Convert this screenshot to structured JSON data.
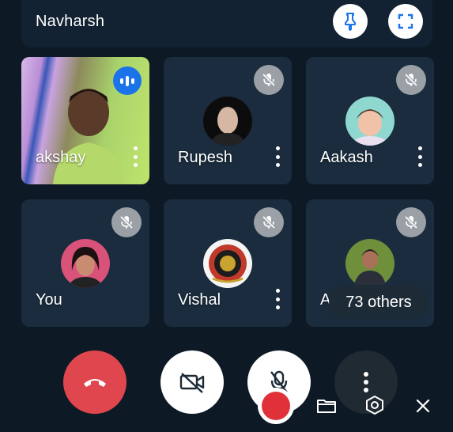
{
  "header": {
    "title": "Navharsh",
    "pin_icon": "pin-icon",
    "fullscreen_icon": "fullscreen-icon"
  },
  "participants": [
    {
      "name": "akshay",
      "video_on": true,
      "speaking": true,
      "muted": false
    },
    {
      "name": "Rupesh",
      "video_on": false,
      "muted": true
    },
    {
      "name": "Aakash",
      "video_on": false,
      "muted": true
    },
    {
      "name": "You",
      "video_on": false,
      "muted": true
    },
    {
      "name": "Vishal",
      "video_on": false,
      "muted": true
    },
    {
      "name": "Anuj",
      "visible_text": "An",
      "video_on": false,
      "muted": true
    }
  ],
  "others_chip": {
    "label": "73 others"
  },
  "controls": [
    {
      "name": "end-call",
      "icon": "phone-hangup-icon",
      "color": "#e0464e"
    },
    {
      "name": "camera-toggle",
      "icon": "video-off-icon",
      "state": "off"
    },
    {
      "name": "mic-toggle",
      "icon": "mic-off-icon",
      "state": "off"
    },
    {
      "name": "more-options",
      "icon": "more-vertical-icon"
    }
  ],
  "recorder_bar": [
    {
      "name": "record",
      "icon": "record-dot-icon",
      "color": "#e0313a"
    },
    {
      "name": "folder",
      "icon": "folder-icon"
    },
    {
      "name": "settings",
      "icon": "hexagon-settings-icon"
    },
    {
      "name": "close",
      "icon": "close-icon"
    }
  ],
  "colors": {
    "background": "#0d1a26",
    "tile": "#1a2c3d",
    "accent_blue": "#1a73e8",
    "end_call_red": "#e0464e"
  }
}
